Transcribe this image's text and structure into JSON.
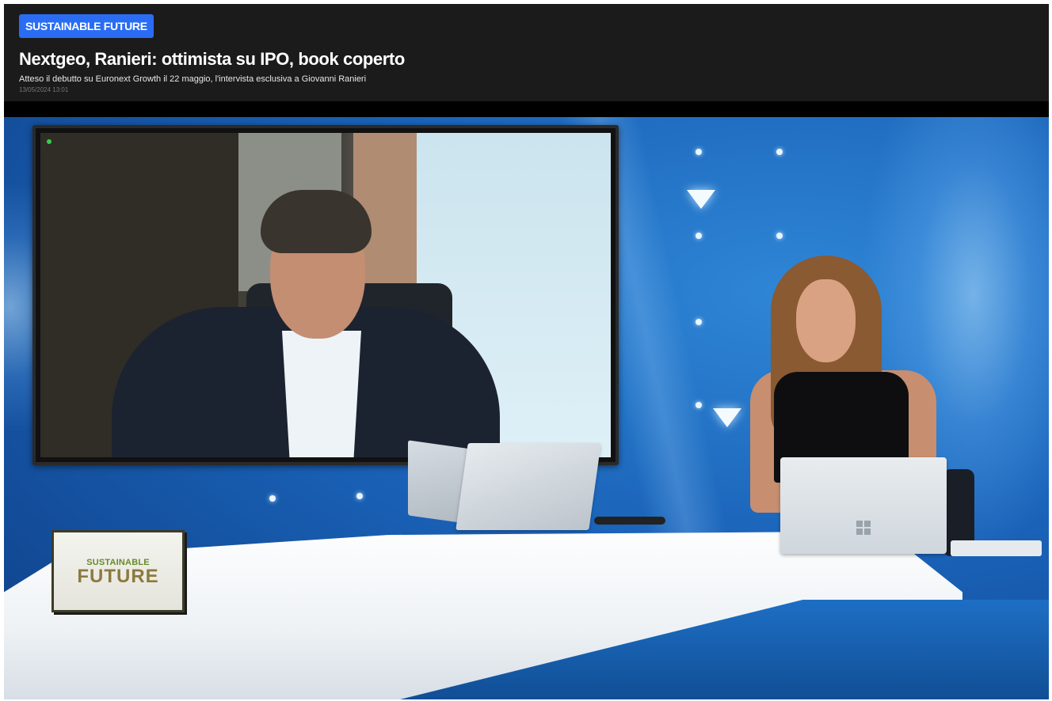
{
  "article": {
    "category": "SUSTAINABLE FUTURE",
    "title": "Nextgeo, Ranieri: ottimista su IPO, book coperto",
    "subtitle": "Atteso il debutto su Euronext Growth il 22 maggio, l'intervista esclusiva a Giovanni Ranieri",
    "date": "13/05/2024 13:01"
  },
  "video": {
    "logo_line1": "SUSTAINABLE",
    "logo_line2": "FUTURE"
  },
  "colors": {
    "header_bg": "#1b1b1b",
    "badge_bg": "#2a6df4",
    "studio_blue": "#1a63b9"
  }
}
